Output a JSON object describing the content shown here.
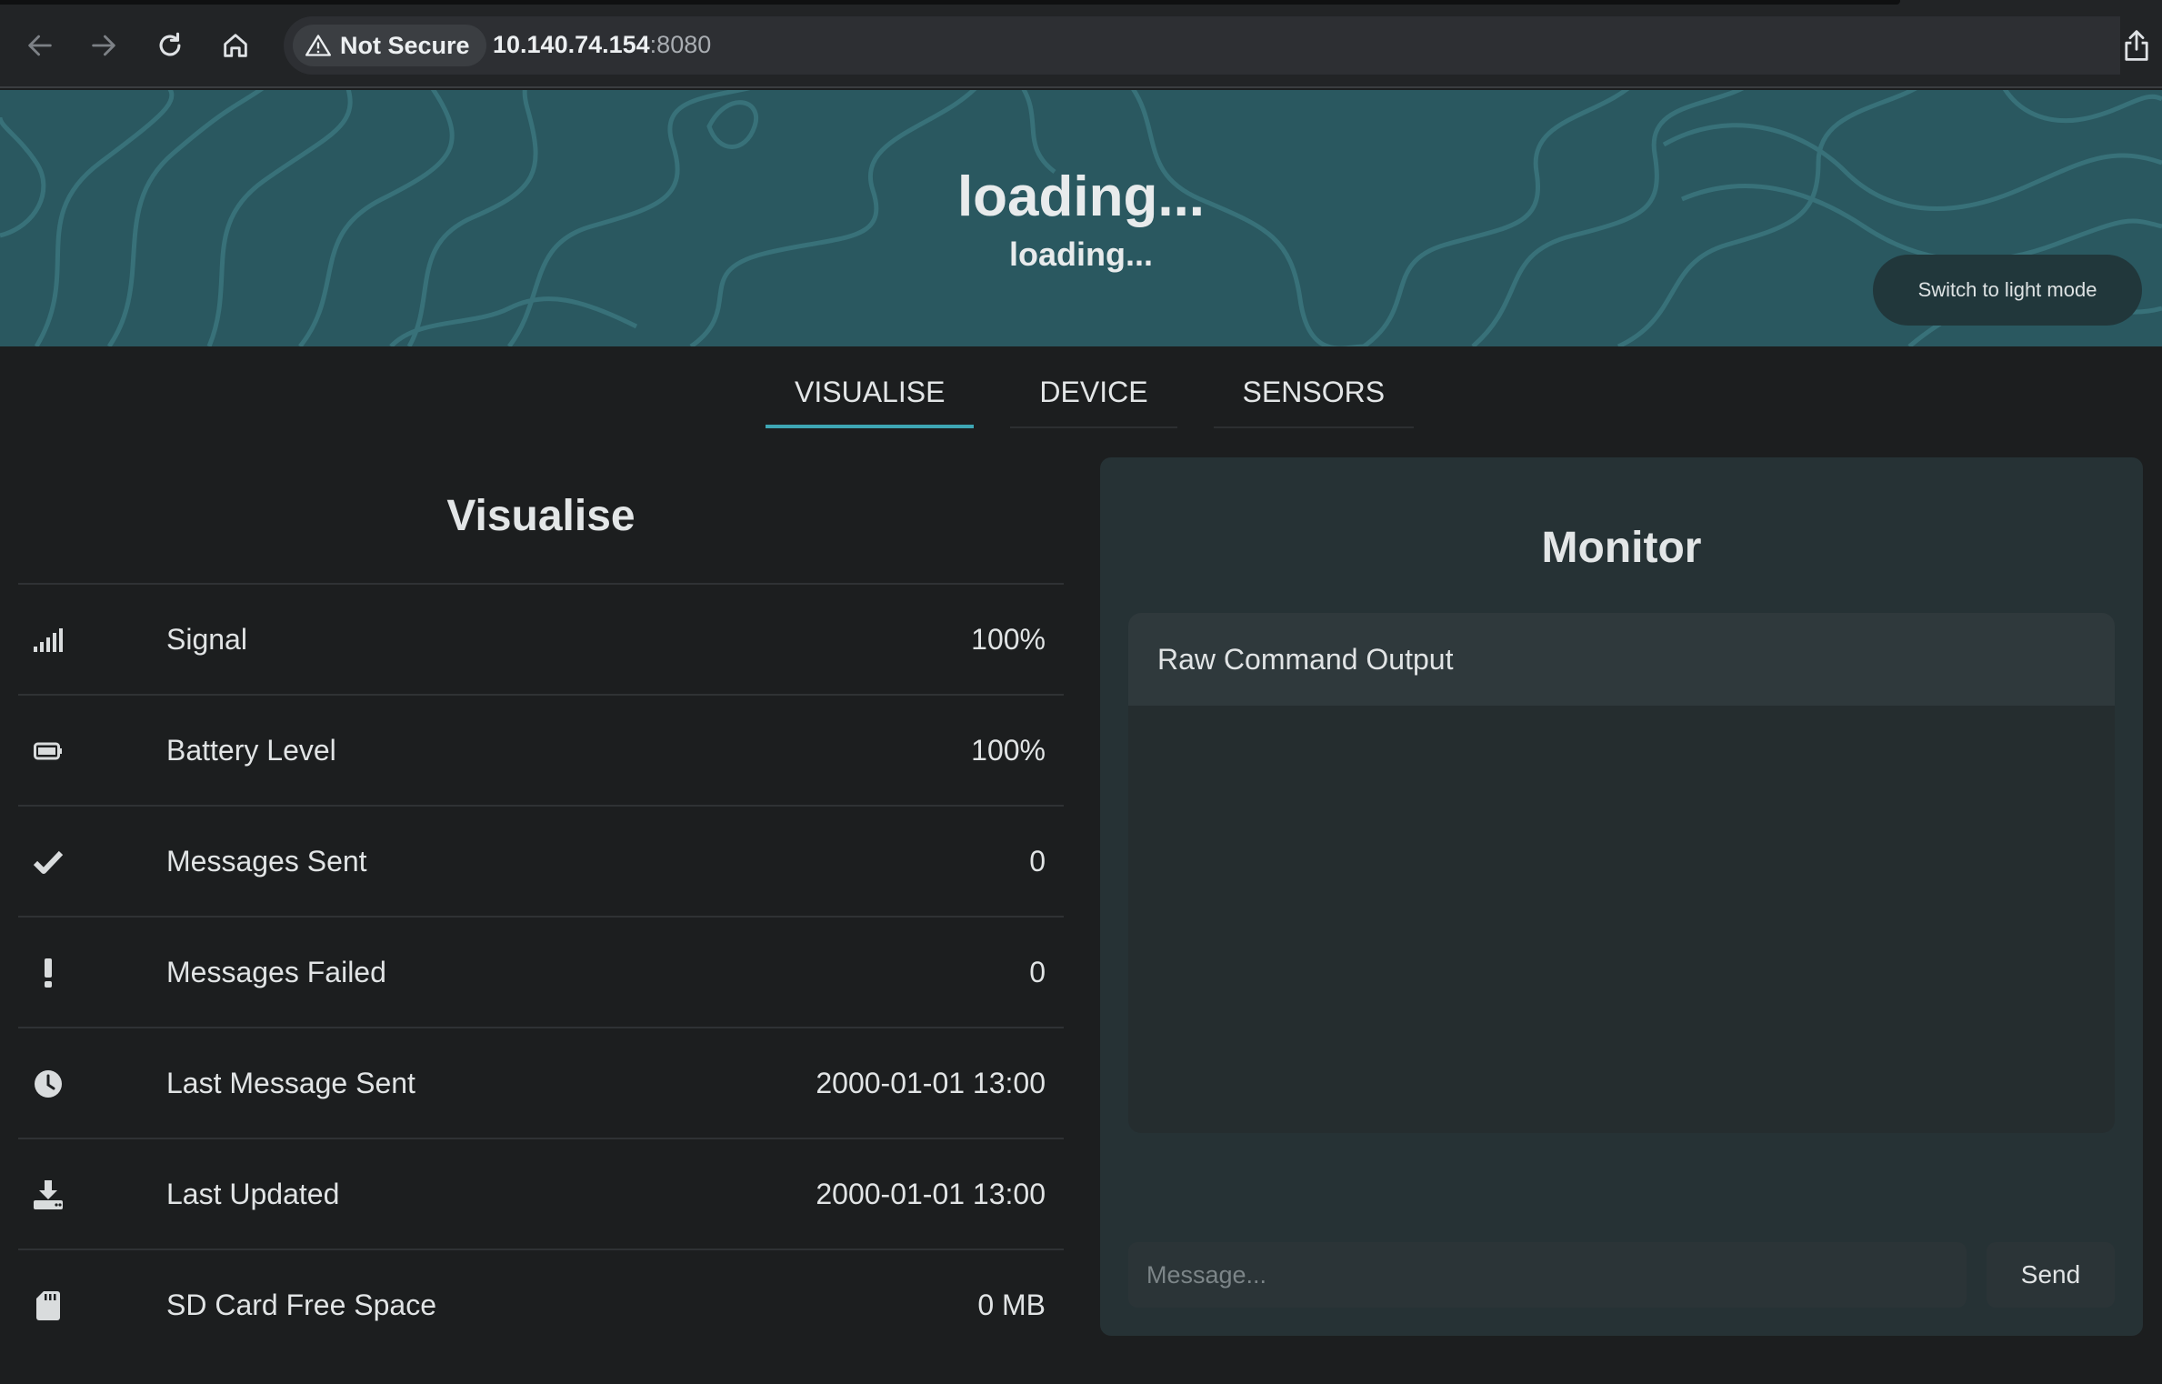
{
  "browser": {
    "security_label": "Not Secure",
    "url_host": "10.140.74.154",
    "url_port": ":8080"
  },
  "header": {
    "title": "loading...",
    "subtitle": "loading...",
    "mode_toggle_label": "Switch to light mode"
  },
  "tabs": [
    {
      "label": "VISUALISE",
      "active": true
    },
    {
      "label": "DEVICE",
      "active": false
    },
    {
      "label": "SENSORS",
      "active": false
    }
  ],
  "visualise": {
    "title": "Visualise",
    "rows": [
      {
        "icon": "signal-icon",
        "label": "Signal",
        "value": "100%"
      },
      {
        "icon": "battery-icon",
        "label": "Battery Level",
        "value": "100%"
      },
      {
        "icon": "checkmark-icon",
        "label": "Messages Sent",
        "value": "0"
      },
      {
        "icon": "exclamation-icon",
        "label": "Messages Failed",
        "value": "0"
      },
      {
        "icon": "clock-icon",
        "label": "Last Message Sent",
        "value": "2000-01-01 13:00"
      },
      {
        "icon": "download-icon",
        "label": "Last Updated",
        "value": "2000-01-01 13:00"
      },
      {
        "icon": "sd-card-icon",
        "label": "SD Card Free Space",
        "value": "0 MB"
      }
    ]
  },
  "monitor": {
    "title": "Monitor",
    "console_header": "Raw Command Output",
    "message_placeholder": "Message...",
    "send_label": "Send"
  },
  "colors": {
    "accent": "#3ea6b4",
    "banner": "#2a5860",
    "background": "#1c1e1f"
  }
}
